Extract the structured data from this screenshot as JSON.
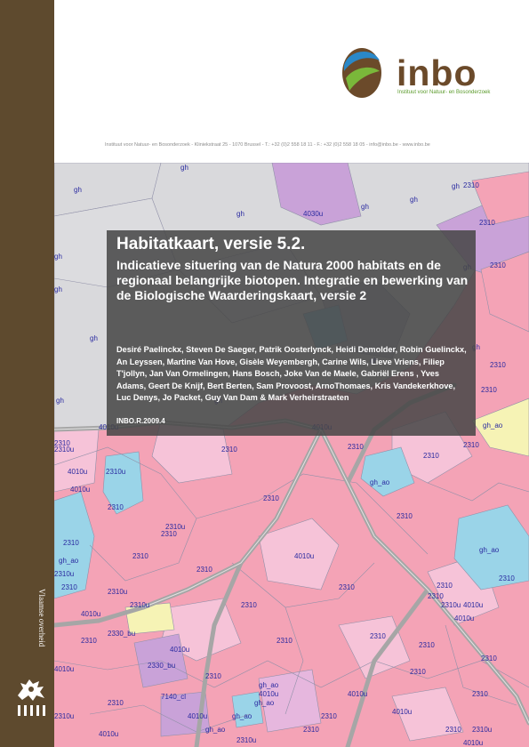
{
  "header": {
    "logo_word": "inbo",
    "logo_subtitle": "Instituut voor Natuur- en Bosonderzoek",
    "contact": "Instituut voor Natuur- en Bosonderzoek - Kliniekstraat 25 - 1070 Brussel - T.: +32 (0)2 558 18 11 - F.: +32 (0)2 558 18 05 - info@inbo.be - www.inbo.be"
  },
  "sidebar": {
    "label": "Vlaamse overheid"
  },
  "cover": {
    "title": "Habitatkaart, versie 5.2.",
    "subtitle": "Indicatieve situering van de Natura 2000 habitats en de regionaal belangrijke biotopen. Integratie en bewerking van de Biologische Waarderingskaart, versie 2",
    "authors": "Desiré Paelinckx, Steven De Saeger, Patrik Oosterlynck, Heidi Demolder, Robin Guelinckx, An Leyssen, Martine Van Hove, Gisèle Weyembergh, Carine Wils, Lieve Vriens, Filiep T'jollyn, Jan Van Ormelingen, Hans Bosch, Joke Van de Maele, Gabriël Erens , Yves Adams, Geert De Knijf, Bert Berten, Sam Provoost, ArnoThomaes, Kris Vandekerkhove, Luc Denys, Jo Packet, Guy Van Dam & Mark Verheirstraeten",
    "report_number": "INBO.R.2009.4"
  },
  "map": {
    "labels": [
      "gh",
      "gh",
      "gh",
      "gh",
      "gh",
      "gh",
      "gh",
      "gh",
      "gh",
      "gh",
      "gh",
      "gh",
      "gh",
      "gh",
      "4030u",
      "2310",
      "2310",
      "2310",
      "2310",
      "2310",
      "2310",
      "2310",
      "2310",
      "2310",
      "2310",
      "2310",
      "2310",
      "2310",
      "2310",
      "2310",
      "2310",
      "2310",
      "2310",
      "2310",
      "2310",
      "2310",
      "2310",
      "2310",
      "2310",
      "2310",
      "2310",
      "2310",
      "2310",
      "2310",
      "2310",
      "2310",
      "2310",
      "2310",
      "2310",
      "2310",
      "4010u",
      "4010u",
      "4010u",
      "4010u",
      "4010u",
      "4010u",
      "4010u",
      "4010u",
      "4010u",
      "4010u",
      "4010u",
      "4010u",
      "4010u",
      "4010u",
      "4010u",
      "2310u",
      "2310u",
      "2310u",
      "2310u",
      "2310u",
      "2310u",
      "2310u",
      "2310u",
      "2310u",
      "gh_ao",
      "gh_ao",
      "gh_ao",
      "gh_ao",
      "gh_ao",
      "gh_ao",
      "gh_ao",
      "gh_ao",
      "2330_bu",
      "2330_bu",
      "7140_cl",
      "2310u",
      "4010u",
      "2310"
    ],
    "colors": {
      "grey": "#d9d9dc",
      "pink": "#f4a3b6",
      "lightpink": "#f6c3d8",
      "mauve": "#e6b7de",
      "purple": "#c9a2d8",
      "blue": "#9ad4e8",
      "yellow": "#f6f3b5",
      "road": "#a6a6a6",
      "border": "#9090a8",
      "label": "#2a2aa0"
    }
  }
}
